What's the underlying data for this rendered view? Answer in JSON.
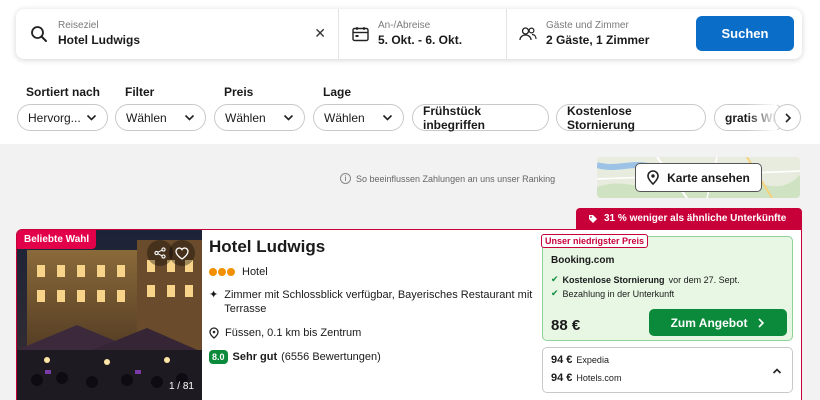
{
  "search": {
    "destination_label": "Reiseziel",
    "destination_value": "Hotel Ludwigs",
    "dates_label": "An-/Abreise",
    "dates_value": "5. Okt. - 6. Okt.",
    "guests_label": "Gäste und Zimmer",
    "guests_value": "2 Gäste, 1 Zimmer",
    "button": "Suchen"
  },
  "filters": {
    "sort": {
      "label": "Sortiert nach",
      "value": "Hervorg..."
    },
    "filter": {
      "label": "Filter",
      "value": "Wählen"
    },
    "price": {
      "label": "Preis",
      "value": "Wählen"
    },
    "location": {
      "label": "Lage",
      "value": "Wählen"
    },
    "chips": [
      "Frühstück inbegriffen",
      "Kostenlose Stornierung",
      "gratis WLAN"
    ]
  },
  "ranking_note": "So beeinflussen Zahlungen an uns unser Ranking",
  "map_button": "Karte ansehen",
  "deal_banner": "31 % weniger als ähnliche Unterkünfte",
  "hotel": {
    "badge": "Beliebte Wahl",
    "photo_counter": "1 / 81",
    "name": "Hotel Ludwigs",
    "type": "Hotel",
    "star_dots": 3,
    "feature": "Zimmer mit Schlossblick verfügbar, Bayerisches Restaurant mit Terrasse",
    "location": "Füssen, 0.1 km bis Zentrum",
    "score": "8.0",
    "score_text": "Sehr gut",
    "reviews": "(6556 Bewertungen)"
  },
  "offer": {
    "tag": "Unser niedrigster Preis",
    "provider": "Booking.com",
    "benefit1_bold": "Kostenlose Stornierung",
    "benefit1_rest": "vor dem 27. Sept.",
    "benefit2": "Bezahlung in der Unterkunft",
    "price": "88 €",
    "cta": "Zum Angebot"
  },
  "other_offers": [
    {
      "price": "94 €",
      "provider": "Expedia"
    },
    {
      "price": "94 €",
      "provider": "Hotels.com"
    }
  ],
  "colors": {
    "primary_blue": "#0a6ec9",
    "deal_red": "#c8003a",
    "green": "#0a8a3a",
    "offer_bg": "#e7f7e4"
  }
}
